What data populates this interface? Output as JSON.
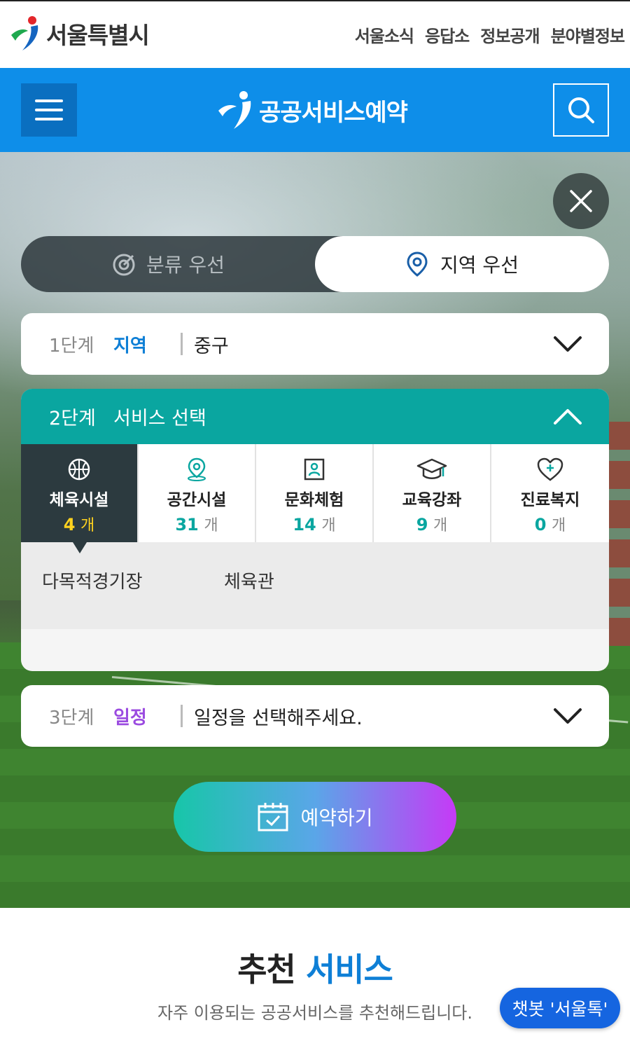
{
  "site": {
    "logo_text": "서울특별시",
    "top_links": [
      "서울소식",
      "응답소",
      "정보공개",
      "분야별정보"
    ]
  },
  "header": {
    "menu_icon": "hamburger-icon",
    "brand_title": "공공서비스예약",
    "search_icon": "search-icon",
    "accent_color": "#0e8ee9"
  },
  "toggle": {
    "left_label": "분류 우선",
    "right_label": "지역 우선",
    "selected": "지역 우선"
  },
  "step1": {
    "number": "1단계",
    "label": "지역",
    "value": "중구",
    "label_color": "#0e7fd6"
  },
  "step2": {
    "number": "2단계",
    "label": "서비스 선택",
    "categories": [
      {
        "name": "체육시설",
        "count": "4",
        "unit": "개",
        "icon": "basketball-icon",
        "active": true
      },
      {
        "name": "공간시설",
        "count": "31",
        "unit": "개",
        "icon": "location-pin-icon",
        "active": false
      },
      {
        "name": "문화체험",
        "count": "14",
        "unit": "개",
        "icon": "frame-person-icon",
        "active": false
      },
      {
        "name": "교육강좌",
        "count": "9",
        "unit": "개",
        "icon": "graduation-cap-icon",
        "active": false
      },
      {
        "name": "진료복지",
        "count": "0",
        "unit": "개",
        "icon": "heart-plus-icon",
        "active": false
      }
    ],
    "subcategories": [
      "다목적경기장",
      "체육관"
    ]
  },
  "step3": {
    "number": "3단계",
    "label": "일정",
    "value": "일정을 선택해주세요.",
    "label_color": "#9b4be0"
  },
  "reserve_button": {
    "label": "예약하기",
    "icon": "calendar-check-icon"
  },
  "recommend": {
    "title_part1": "추천",
    "title_part2": "서비스",
    "description": "자주 이용되는 공공서비스를 추천해드립니다."
  },
  "chatbot": {
    "label": "챗봇 '서울톡'"
  }
}
